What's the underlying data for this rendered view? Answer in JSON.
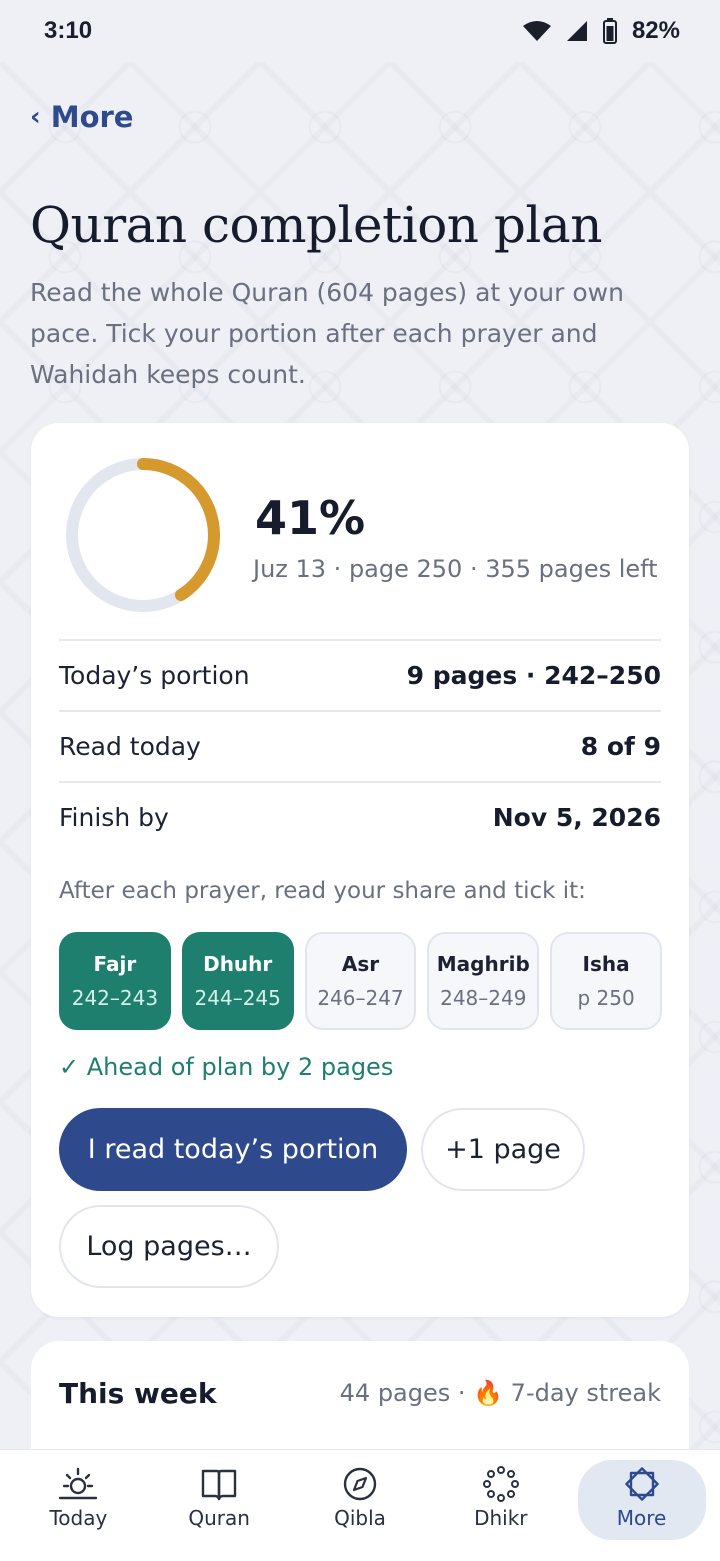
{
  "status_bar": {
    "time": "3:10",
    "battery": "82%"
  },
  "nav": {
    "back_label": "More"
  },
  "page": {
    "title": "Quran completion plan",
    "subtitle": "Read the whole Quran (604 pages) at your own pace. Tick your portion after each prayer and Wahidah keeps count."
  },
  "progress": {
    "percent_label": "41%",
    "percent_value": 0.41,
    "location": "Juz 13 · page 250 · 355 pages left",
    "ring_color": "#d6992e"
  },
  "stats": [
    {
      "label": "Today’s portion",
      "value": "9 pages · 242–250"
    },
    {
      "label": "Read today",
      "value": "8 of 9"
    },
    {
      "label": "Finish by",
      "value": "Nov 5, 2026"
    }
  ],
  "prayers_heading": "After each prayer, read your share and tick it:",
  "prayers": [
    {
      "name": "Fajr",
      "range": "242–243",
      "done": true
    },
    {
      "name": "Dhuhr",
      "range": "244–245",
      "done": true
    },
    {
      "name": "Asr",
      "range": "246–247",
      "done": false
    },
    {
      "name": "Maghrib",
      "range": "248–249",
      "done": false
    },
    {
      "name": "Isha",
      "range": "p 250",
      "done": false
    }
  ],
  "ahead_text": "✓ Ahead of plan by 2 pages",
  "actions": {
    "read_portion": "I read today’s portion",
    "plus_one": "+1 page",
    "log_pages": "Log pages…"
  },
  "week": {
    "title": "This week",
    "summary": "44 pages · 🔥 7-day streak"
  },
  "tabs": [
    {
      "label": "Today",
      "icon": "sun-icon",
      "active": false
    },
    {
      "label": "Quran",
      "icon": "book-icon",
      "active": false
    },
    {
      "label": "Qibla",
      "icon": "compass-icon",
      "active": false
    },
    {
      "label": "Dhikr",
      "icon": "beads-icon",
      "active": false
    },
    {
      "label": "More",
      "icon": "star-icon",
      "active": true
    }
  ],
  "colors": {
    "accent": "#2e4a8c",
    "done": "#1f7f6e",
    "ring_track": "#e2e6ee"
  }
}
